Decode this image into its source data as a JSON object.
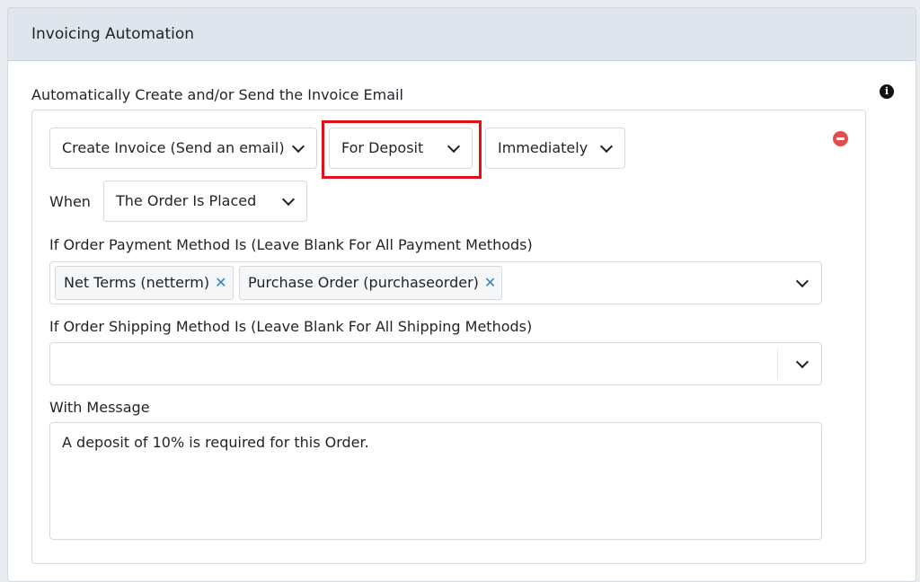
{
  "panel": {
    "title": "Invoicing Automation"
  },
  "section": {
    "label": "Automatically Create and/or Send the Invoice Email"
  },
  "rule": {
    "action_select": "Create Invoice (Send an email)",
    "target_select": "For Deposit",
    "timing_select": "Immediately",
    "when_label": "When",
    "when_select": "The Order Is Placed",
    "payment_label": "If Order Payment Method Is (Leave Blank For All Payment Methods)",
    "payment_tags": [
      {
        "label": "Net Terms (netterm)"
      },
      {
        "label": "Purchase Order (purchaseorder)"
      }
    ],
    "shipping_label": "If Order Shipping Method Is (Leave Blank For All Shipping Methods)",
    "shipping_value": "",
    "message_label": "With Message",
    "message_value": "A deposit of 10% is required for this Order."
  },
  "icons": {
    "info": "info-circle-icon",
    "remove": "remove-circle-icon",
    "chevron": "chevron-down-icon",
    "tag_remove": "close-icon"
  },
  "colors": {
    "highlight": "#e3101b",
    "remove": "#e04e4e",
    "tag_x": "#2f86c4",
    "header_bg": "#dfe5ec"
  }
}
